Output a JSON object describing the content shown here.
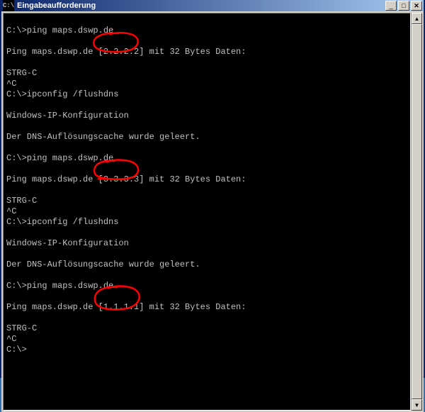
{
  "window": {
    "title": "Eingabeaufforderung",
    "icon_text": "C:\\"
  },
  "lines": {
    "l0": "C:\\>ping maps.dswp.de",
    "l1": "",
    "l2": "Ping maps.dswp.de [2.2.2.2] mit 32 Bytes Daten:",
    "l3": "",
    "l4": "STRG-C",
    "l5": "^C",
    "l6": "C:\\>ipconfig /flushdns",
    "l7": "",
    "l8": "Windows-IP-Konfiguration",
    "l9": "",
    "l10": "Der DNS-Auflösungscache wurde geleert.",
    "l11": "",
    "l12": "C:\\>ping maps.dswp.de",
    "l13": "",
    "l14": "Ping maps.dswp.de [3.3.3.3] mit 32 Bytes Daten:",
    "l15": "",
    "l16": "STRG-C",
    "l17": "^C",
    "l18": "C:\\>ipconfig /flushdns",
    "l19": "",
    "l20": "Windows-IP-Konfiguration",
    "l21": "",
    "l22": "Der DNS-Auflösungscache wurde geleert.",
    "l23": "",
    "l24": "C:\\>ping maps.dswp.de",
    "l25": "",
    "l26": "Ping maps.dswp.de [1.1.1.1] mit 32 Bytes Daten:",
    "l27": "",
    "l28": "STRG-C",
    "l29": "^C",
    "l30": "C:\\>"
  },
  "annotations": {
    "circle1_target": "[2.2.2.2]",
    "circle2_target": "[3.3.3.3]",
    "circle3_target": "[1.1.1.1]",
    "color": "#ff0000"
  }
}
